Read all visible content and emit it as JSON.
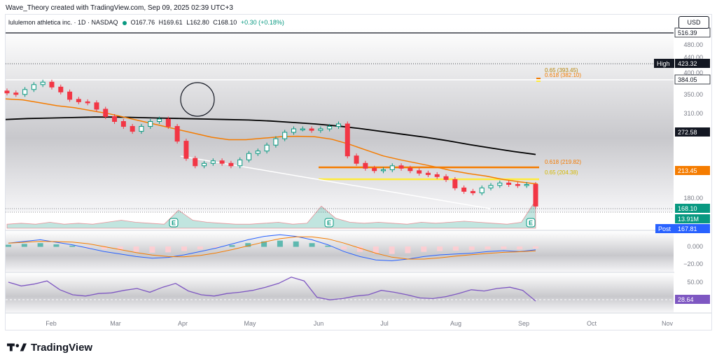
{
  "header": {
    "caption": "Wave_Theory created with TradingView.com, Sep 09, 2025 02:39 UTC+3"
  },
  "symbol": {
    "name": "lululemon athletica inc. · 1D · NASDAQ",
    "open_label": "O",
    "open": "167.76",
    "high_label": "H",
    "high": "169.61",
    "low_label": "L",
    "low": "162.80",
    "close_label": "C",
    "close": "168.10",
    "change": "+0.30 (+0.18%)"
  },
  "currency": "USD",
  "price_axis": {
    "ticks": [
      "480.00",
      "440.00",
      "400.00",
      "350.00",
      "310.00",
      "180.00"
    ],
    "tags": {
      "level_516": "516.39",
      "high_label": "High",
      "high_value": "423.32",
      "level_384": "384.05",
      "ma200": "272.58",
      "ma50": "213.45",
      "last_price": "168.10",
      "volume": "13.91M",
      "post_label": "Post",
      "post_value": "167.81"
    }
  },
  "fib_labels": {
    "top_065": "0.65 (393.45)",
    "top_0618": "0.618 (382.10)",
    "low_0618": "0.618 (219.82)",
    "low_065": "0.65 (204.38)"
  },
  "macd_axis": {
    "ticks": [
      "0.000",
      "−20.00"
    ]
  },
  "rsi_axis": {
    "tick": "50.00",
    "value": "28.64"
  },
  "x_axis": {
    "months": [
      "Feb",
      "Mar",
      "Apr",
      "May",
      "Jun",
      "Jul",
      "Aug",
      "Sep",
      "Oct",
      "Nov"
    ]
  },
  "earnings_marker": "E",
  "brand": "TradingView",
  "colors": {
    "up": "#089981",
    "down": "#f23645",
    "ma50": "#f57c00",
    "ma200": "#000000",
    "fib_orange": "#f57c00",
    "fib_yellow": "#ffeb3b",
    "rsi": "#7e57c2",
    "macd_line": "#2962ff",
    "signal_line": "#f57c00",
    "post": "#2962ff"
  },
  "chart_data": {
    "type": "candlestick",
    "months": [
      "Feb",
      "Mar",
      "Apr",
      "May",
      "Jun",
      "Jul",
      "Aug",
      "Sep",
      "Oct",
      "Nov"
    ],
    "close_series": [
      398,
      395,
      405,
      415,
      420,
      410,
      400,
      385,
      380,
      378,
      365,
      350,
      340,
      330,
      320,
      330,
      340,
      345,
      330,
      300,
      265,
      250,
      255,
      260,
      255,
      250,
      262,
      275,
      280,
      292,
      305,
      318,
      325,
      325,
      322,
      325,
      330,
      335,
      270,
      255,
      245,
      240,
      242,
      250,
      245,
      240,
      235,
      232,
      228,
      222,
      205,
      198,
      195,
      205,
      210,
      215,
      212,
      210,
      212,
      168
    ],
    "ma50_series": [
      386,
      384,
      378,
      372,
      368,
      362,
      356,
      348,
      340,
      332,
      324,
      316,
      308,
      303,
      303,
      306,
      309,
      310,
      309,
      304,
      294,
      282,
      270,
      262,
      255,
      248,
      240,
      234,
      229,
      222,
      217,
      213
    ],
    "ma200_series": [
      344,
      346,
      347,
      348,
      349,
      349,
      348,
      347,
      346,
      345,
      344,
      343,
      341,
      338,
      335,
      331,
      326,
      320,
      314,
      308,
      301,
      293,
      286,
      279,
      273
    ],
    "rsi_series": [
      58,
      52,
      55,
      60,
      46,
      38,
      36,
      40,
      41,
      45,
      48,
      42,
      50,
      56,
      44,
      38,
      36,
      40,
      42,
      45,
      50,
      56,
      66,
      60,
      34,
      30,
      32,
      36,
      38,
      45,
      42,
      38,
      33,
      32,
      35,
      40,
      46,
      44,
      48,
      50,
      45,
      28
    ],
    "macd_series": [
      4,
      6,
      8,
      5,
      2,
      -2,
      -6,
      -9,
      -12,
      -14,
      -13,
      -10,
      -6,
      -2,
      3,
      8,
      12,
      14,
      12,
      8,
      2,
      -6,
      -12,
      -16,
      -17,
      -15,
      -12,
      -10,
      -9,
      -8,
      -6,
      -5,
      -6,
      -4
    ],
    "volume_series": [
      2,
      2.5,
      2,
      3,
      2,
      2.5,
      2,
      3,
      4,
      3,
      2.5,
      2,
      9,
      4,
      3,
      2.5,
      2,
      2,
      2.5,
      3,
      2,
      2.5,
      11,
      5,
      3,
      2.5,
      3,
      2.5,
      2,
      3,
      2.5,
      3,
      3.5,
      3,
      2.5,
      2,
      3,
      13.91
    ],
    "price_range": [
      160,
      530
    ],
    "rsi_levels": [
      50
    ],
    "fib_levels": [
      {
        "ratio": "0.65",
        "price": 393.45
      },
      {
        "ratio": "0.618",
        "price": 382.1
      },
      {
        "ratio": "0.618",
        "price": 219.82
      },
      {
        "ratio": "0.65",
        "price": 204.38
      }
    ],
    "horizontal_levels": [
      516.39,
      423.32,
      384.05
    ],
    "last": 168.1,
    "ma50": 213.45,
    "ma200": 272.58,
    "volume": "13.91M",
    "rsi": 28.64
  }
}
